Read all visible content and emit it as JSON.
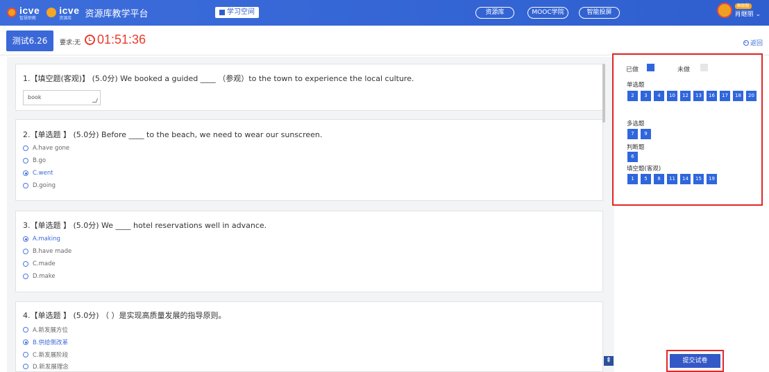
{
  "header": {
    "logo1": "icve",
    "logo1_sub": "智慧职教",
    "logo2": "icve",
    "logo2_sub": "资源库",
    "platform": "资源库教学平台",
    "study_space": "学习空间",
    "nav": [
      "资源库",
      "MOOC学院",
      "智能投屏"
    ],
    "vip_badge": "高级版",
    "user_name": "肖继丽"
  },
  "subheader": {
    "test_tab": "测试6.26",
    "requirement": "要求:无",
    "timer": "01:51:36",
    "back": "返回"
  },
  "questions": [
    {
      "title": "1.【填空题(客观)】 (5.0分) We booked a guided ____ （参观）to the  town to experience the local culture.",
      "answer": "book"
    },
    {
      "title": "2.【单选题 】 (5.0分) Before ____ to the beach, we need to wear our sunscreen.",
      "options": [
        "A.have gone",
        "B.go",
        "C.went",
        "D.going"
      ],
      "selected": 2
    },
    {
      "title": "3.【单选题 】 (5.0分) We ____ hotel reservations well in advance.",
      "options": [
        "A.making",
        "B.have made",
        "C.made",
        "D.make"
      ],
      "selected": 0
    },
    {
      "title": "4.【单选题 】 (5.0分) （ ）是实现高质量发展的指导原则。",
      "options": [
        "A.新发展方位",
        "B.供给侧改革",
        "C.新发展阶段",
        "D.新发展理念"
      ],
      "selected": 1
    }
  ],
  "panel": {
    "done_label": "已做",
    "undone_label": "未做",
    "done_color": "#2f66dc",
    "undone_color": "#e6e6e6",
    "groups": [
      {
        "label": "单选题",
        "nums": [
          "2",
          "3",
          "4",
          "10",
          "12",
          "13",
          "16",
          "17",
          "18",
          "20"
        ]
      },
      {
        "label": "多选题",
        "nums": [
          "7",
          "9"
        ]
      },
      {
        "label": "判断题",
        "nums": [
          "6"
        ]
      },
      {
        "label": "填空题(客观)",
        "nums": [
          "1",
          "5",
          "8",
          "11",
          "14",
          "15",
          "19"
        ]
      }
    ],
    "submit": "提交试卷"
  },
  "colors": {
    "brand": "#2f5fcf",
    "timer": "#e83a2a",
    "highlight": "#e52525"
  },
  "icons": [
    "clock-icon",
    "back-icon",
    "radio-icon",
    "to-top-icon",
    "resize-grip-icon"
  ]
}
